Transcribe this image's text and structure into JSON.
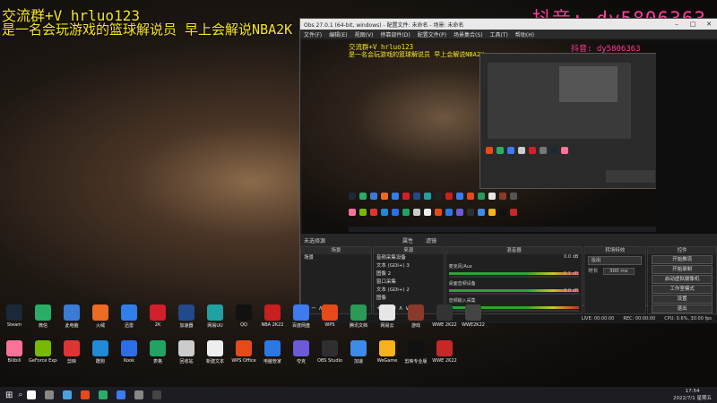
{
  "overlay": {
    "line1": "交流群+V hrluo123",
    "line2": "是一名会玩游戏的篮球解说员 早上会解说NBA2K",
    "douyin": "抖音: dy5806363"
  },
  "obs": {
    "title": "Obs 27.0.1 (64-bit, windows) - 配置文件: 未命名 - 场景: 未命名",
    "menus": [
      "文件(F)",
      "编辑(E)",
      "视图(V)",
      "停靠部件(D)",
      "配置文件(P)",
      "场景集合(S)",
      "工具(T)",
      "帮助(H)"
    ],
    "preview_line1": "交流群+V hrluo123",
    "preview_line2": "是一名会玩游戏的篮球解说员 早上会解说NBA2K",
    "preview_douyin": "抖音: dy5806363",
    "unselected_label": "未选择源",
    "props_label": "属性",
    "filters_label": "滤镜",
    "panels": {
      "scenes_hdr": "场景",
      "sources_hdr": "来源",
      "mixer_hdr": "混音器",
      "transitions_hdr": "转场特效",
      "controls_hdr": "控件"
    },
    "scenes": [
      "场景"
    ],
    "sources": [
      "音频采集设备",
      "文本 (GDI+) 3",
      "图像 2",
      "窗口采集",
      "文本 (GDI+) 2",
      "图像"
    ],
    "mixer": [
      {
        "name": "麦克风/Aux",
        "db": "0.0 dB"
      },
      {
        "name": "桌面音频设备",
        "db": "-5.1 dB"
      },
      {
        "name": "音频输入采集",
        "db": "0.0 dB"
      }
    ],
    "transition": {
      "type": "淡出",
      "duration_label": "时长",
      "duration": "300 ms"
    },
    "controls": [
      "开始推流",
      "开始录制",
      "启动虚拟摄像机",
      "工作室模式",
      "设置",
      "退出"
    ],
    "status": {
      "live": "LIVE: 00:00:00",
      "rec": "REC: 00:00:00",
      "cpu": "CPU: 0.6%, 30.00 fps"
    }
  },
  "desktop": {
    "row1": [
      {
        "label": "Steam",
        "color": "#1b2838"
      },
      {
        "label": "微信",
        "color": "#2aae67"
      },
      {
        "label": "此电脑",
        "color": "#3a7bd5"
      },
      {
        "label": "火绒",
        "color": "#ec6a23"
      },
      {
        "label": "迅雷",
        "color": "#2f7ee9"
      },
      {
        "label": "2K",
        "color": "#d21f2b"
      },
      {
        "label": "加速器",
        "color": "#214a8a"
      },
      {
        "label": "网易UU",
        "color": "#20a0a0"
      },
      {
        "label": "QQ",
        "color": "#111111"
      },
      {
        "label": "NBA 2K22",
        "color": "#c82020"
      },
      {
        "label": "百度网盘",
        "color": "#3c7bf0"
      },
      {
        "label": "WPS",
        "color": "#e64a19"
      },
      {
        "label": "腾讯文档",
        "color": "#2a9a56"
      },
      {
        "label": "网易云",
        "color": "#e6e6e6"
      },
      {
        "label": "游戏",
        "color": "#8a3a2a"
      },
      {
        "label": "WWE 2K22",
        "color": "#333333"
      },
      {
        "label": "WWE2K22",
        "color": "#444444"
      }
    ],
    "row2": [
      {
        "label": "Bilibili",
        "color": "#fb7299"
      },
      {
        "label": "GeForce Experience",
        "color": "#76b900"
      },
      {
        "label": "剪映",
        "color": "#e03434"
      },
      {
        "label": "酷狗",
        "color": "#2089d8"
      },
      {
        "label": "Kook",
        "color": "#2c6ee8"
      },
      {
        "label": "表格",
        "color": "#21a366"
      },
      {
        "label": "回收站",
        "color": "#cccccc"
      },
      {
        "label": "新建文本",
        "color": "#eeeeee"
      },
      {
        "label": "WPS Office",
        "color": "#e64a19"
      },
      {
        "label": "电脑管家",
        "color": "#2b78e4"
      },
      {
        "label": "夸克",
        "color": "#6b5bd8"
      },
      {
        "label": "OBS Studio",
        "color": "#302e31"
      },
      {
        "label": "加速",
        "color": "#3d8be8"
      },
      {
        "label": "WeGame",
        "color": "#f6b21b"
      },
      {
        "label": "剪映专业版",
        "color": "#111111"
      },
      {
        "label": "WWE 2K22",
        "color": "#c62828"
      }
    ]
  },
  "taskbar": {
    "time": "17:54",
    "date": "2022/7/1 星期五",
    "icons": [
      "#ffffff",
      "#888888",
      "#4aa3df",
      "#e64a19",
      "#2aae67",
      "#3c7bf0",
      "#888888",
      "#444444"
    ]
  }
}
